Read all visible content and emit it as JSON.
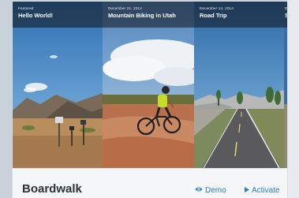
{
  "theme": {
    "name": "Boardwalk",
    "actions": {
      "demo_label": "Demo",
      "activate_label": "Activate"
    }
  },
  "panels": [
    {
      "category": "Featured",
      "title": "Hello World!"
    },
    {
      "category": "December 21, 2014",
      "title": "Mountain Biking in Utah"
    },
    {
      "category": "December 14, 2014",
      "title": "Road Trip"
    },
    {
      "category": "D",
      "title": "S"
    }
  ],
  "icons": {
    "demo": "eye-icon",
    "activate": "play-icon"
  },
  "colors": {
    "action_link": "#2e7cc0",
    "title_text": "#2c3338",
    "footer_bg": "#f4f6f7",
    "caption_overlay": "#121216"
  }
}
